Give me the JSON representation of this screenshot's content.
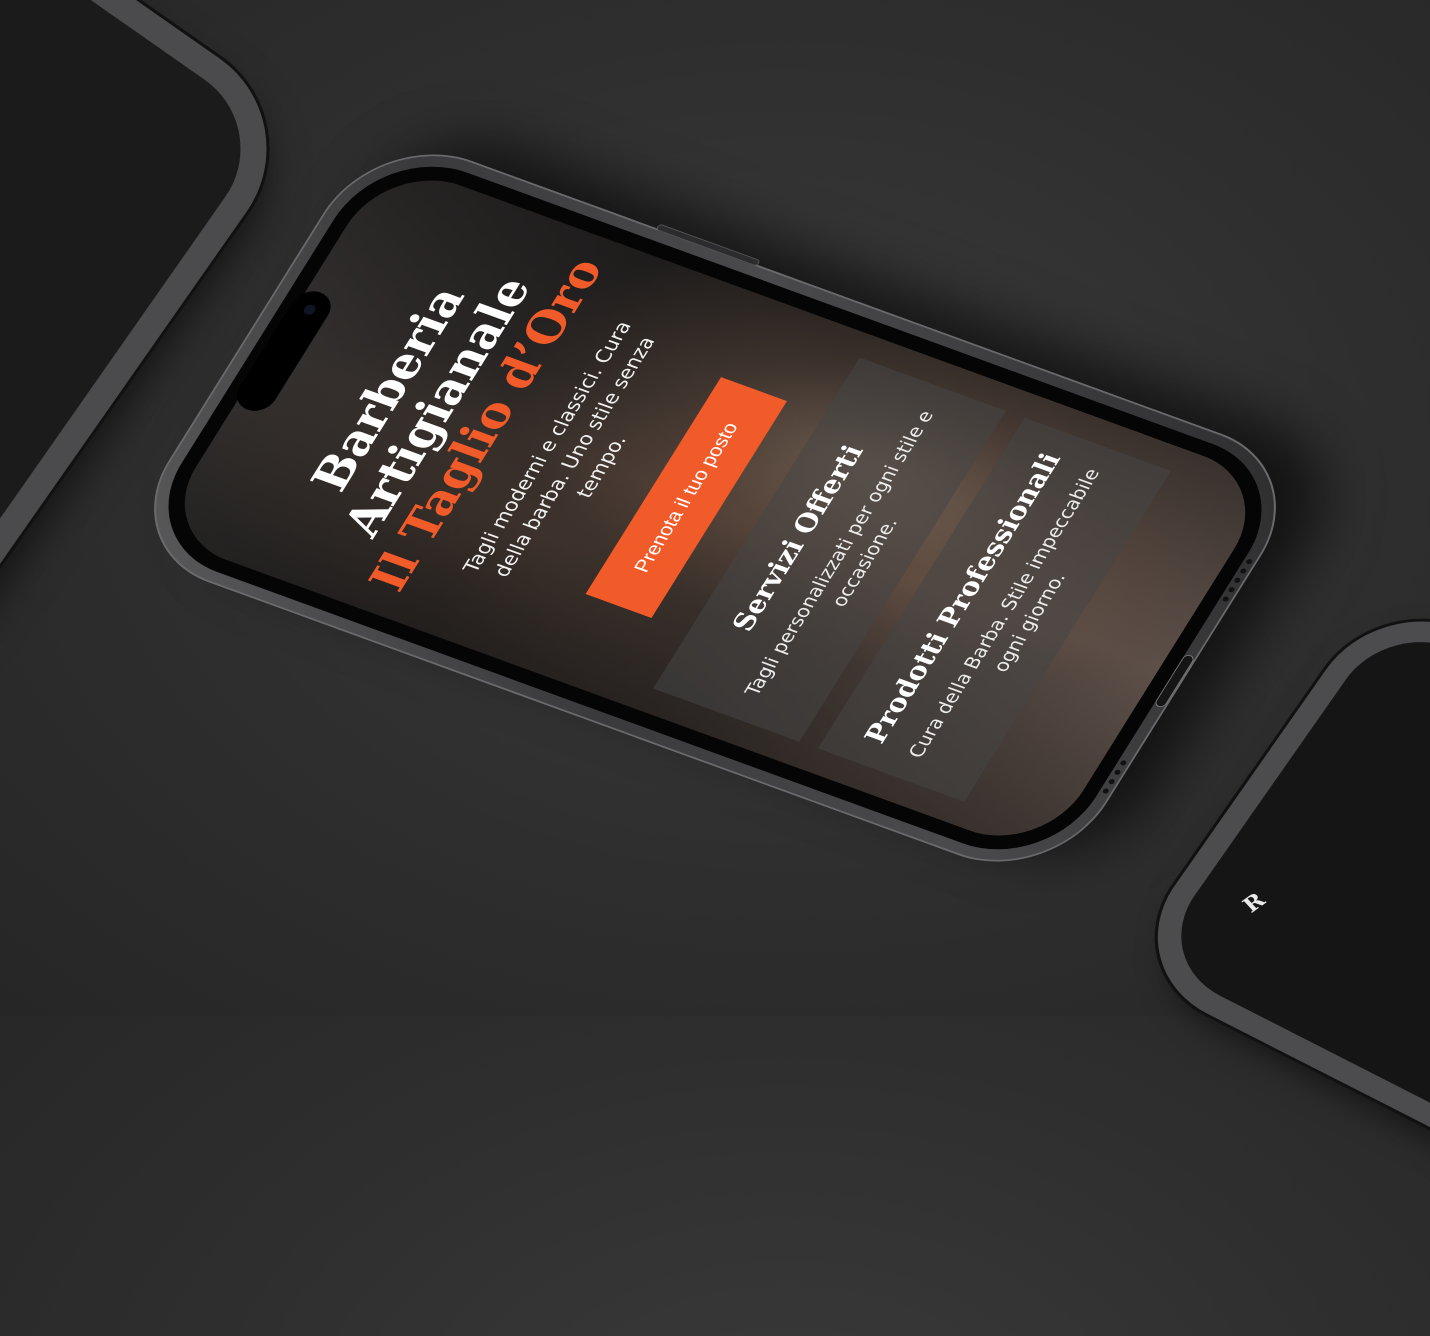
{
  "hero": {
    "title": "Barberia Artigianale",
    "subtitle": "Il Taglio d’Oro",
    "tagline": "Tagli moderni e classici. Cura della barba. Uno stile senza tempo.",
    "cta_label": "Prenota il tuo posto"
  },
  "cards": [
    {
      "title": "Servizi Offerti",
      "text": "Tagli personalizzati per ogni stile e occasione."
    },
    {
      "title": "Prodotti Professionali",
      "text": "Cura della Barba. Stile impeccabile ogni giorno."
    }
  ],
  "side_phone_right": {
    "peek_text": "R"
  },
  "colors": {
    "accent": "#f15a29",
    "background": "#2e2e2e",
    "frame": "#4a4a4c"
  }
}
